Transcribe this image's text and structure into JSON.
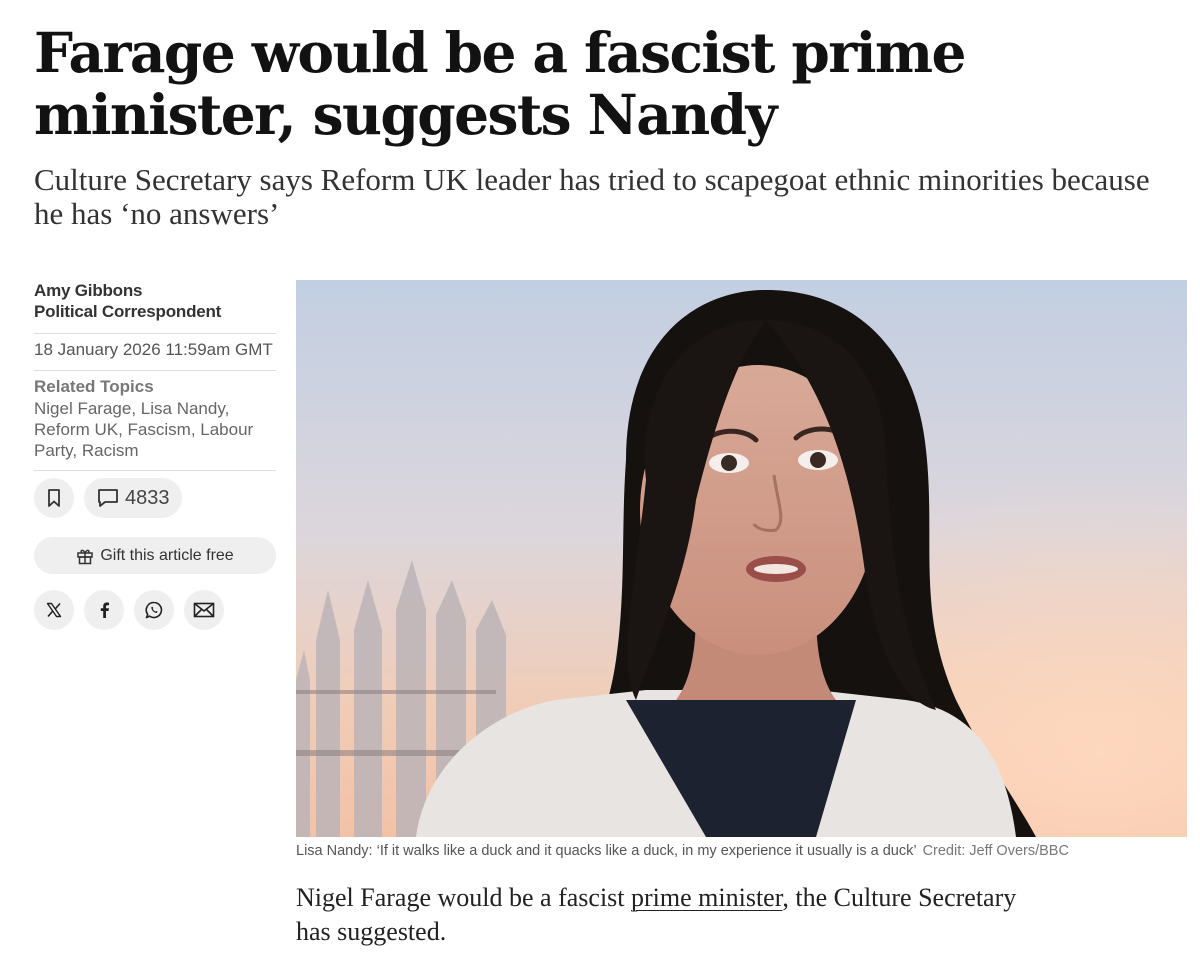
{
  "article": {
    "headline": "Farage would be a fascist prime minister, suggests Nandy",
    "standfirst": "Culture Secretary says Reform UK leader has tried to scapegoat ethnic minorities because he has ‘no answers’"
  },
  "byline": {
    "author": "Amy Gibbons",
    "role": "Political Correspondent",
    "date": "18 January 2026 11:59am GMT"
  },
  "related": {
    "title": "Related Topics",
    "topics": [
      "Nigel Farage",
      "Lisa Nandy",
      "Reform UK",
      "Fascism",
      "Labour Party",
      "Racism"
    ]
  },
  "actions": {
    "save_icon": "bookmark-icon",
    "comment_icon": "speech-bubble-icon",
    "comment_count": "4833",
    "gift_icon": "gift-icon",
    "gift_label": "Gift this article free"
  },
  "share": {
    "icons": [
      "x-icon",
      "facebook-icon",
      "whatsapp-icon",
      "email-icon"
    ]
  },
  "image": {
    "caption": "Lisa Nandy: ‘If it walks like a duck and it quacks like a duck, in my experience it usually is a duck’",
    "credit": "Credit: Jeff Overs/BBC"
  },
  "body": {
    "para_before": "Nigel Farage would be a fascist ",
    "para_link": "prime minister",
    "para_after": ", the Culture Secretary has suggested."
  },
  "colors": {
    "text": "#121212",
    "muted": "#666666",
    "button_bg": "#efefef",
    "divider": "#dcdcdc"
  }
}
